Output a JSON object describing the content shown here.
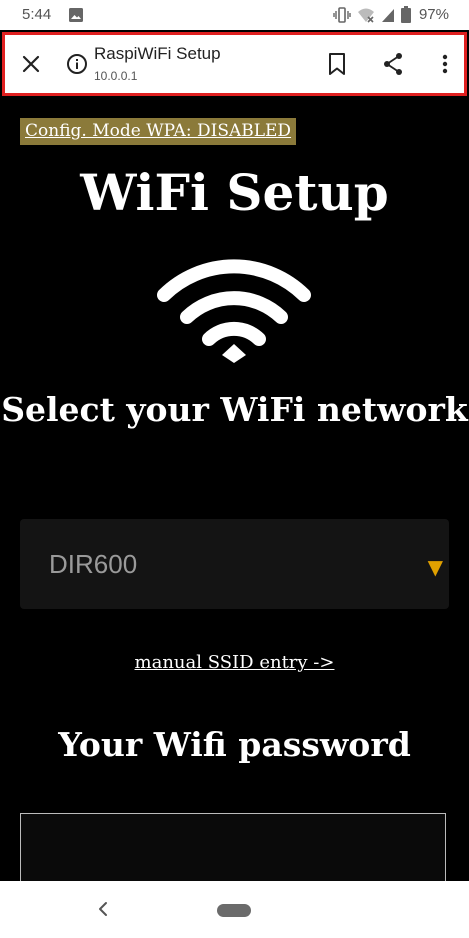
{
  "status_bar": {
    "time": "5:44",
    "battery_percent": "97%",
    "icons": [
      "photo-icon",
      "vibrate-icon",
      "wifi-off-icon",
      "signal-icon",
      "battery-icon"
    ]
  },
  "toolbar": {
    "title": "RaspiWiFi Setup",
    "url": "10.0.0.1",
    "icons": [
      "close-icon",
      "info-icon",
      "bookmark-icon",
      "share-icon",
      "more-vert-icon"
    ]
  },
  "page": {
    "config_badge": "Config. Mode WPA: DISABLED",
    "title": "WiFi Setup",
    "wifi_icon": "wifi-icon",
    "select_heading": "Select your WiFi network",
    "network_select": {
      "selected_value": "DIR600",
      "arrow": "▼"
    },
    "manual_link": "manual SSID entry ->",
    "password_heading": "Your Wifi password",
    "password_value": ""
  },
  "colors": {
    "background": "#000000",
    "badge_bg": "#8b7a3a",
    "select_bg": "#141414",
    "select_arrow": "#e0a000",
    "toolbar_highlight": "#e02020"
  },
  "nav_bar": {
    "icons": [
      "back-icon",
      "home-pill-icon"
    ]
  }
}
